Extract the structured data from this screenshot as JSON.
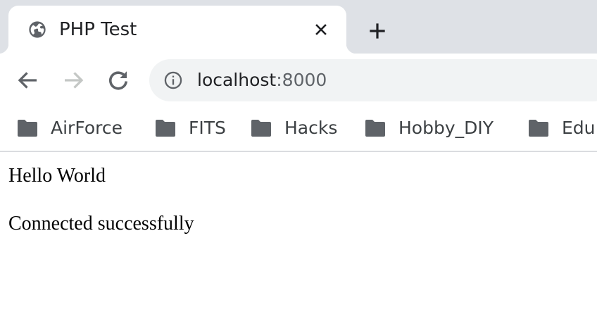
{
  "tab": {
    "title": "PHP Test",
    "favicon": "globe-icon",
    "close_icon": "close-icon"
  },
  "new_tab_icon": "plus-icon",
  "toolbar": {
    "back_icon": "arrow-left-icon",
    "forward_icon": "arrow-right-icon",
    "reload_icon": "reload-icon",
    "info_icon": "info-icon",
    "url_host": "localhost",
    "url_port": ":8000"
  },
  "bookmarks": [
    {
      "label": "AirForce",
      "icon": "folder-icon"
    },
    {
      "label": "FITS",
      "icon": "folder-icon"
    },
    {
      "label": "Hacks",
      "icon": "folder-icon"
    },
    {
      "label": "Hobby_DIY",
      "icon": "folder-icon"
    },
    {
      "label": "Edu",
      "icon": "folder-icon"
    }
  ],
  "page": {
    "line1": "Hello World",
    "line2": "Connected successfully"
  },
  "colors": {
    "tab_strip_bg": "#dee1e6",
    "omnibox_bg": "#f1f3f4",
    "icon": "#5f6368",
    "folder": "#5f6368",
    "text": "#202124"
  }
}
